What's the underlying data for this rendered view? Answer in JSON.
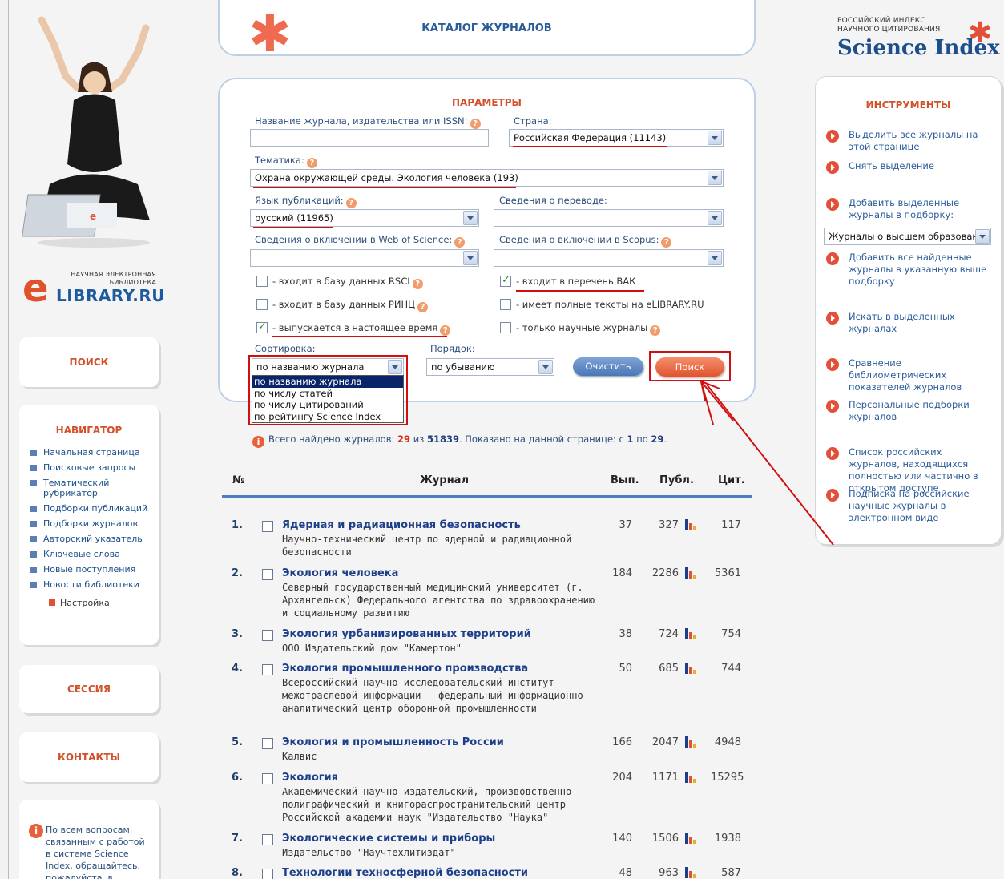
{
  "left": {
    "logo_small": "НАУЧНАЯ ЭЛЕКТРОННАЯ\nБИБЛИОТЕКА",
    "logo_e": "e",
    "logo_lib": "LIBRARY.RU",
    "search_label": "ПОИСК",
    "navigator_title": "НАВИГАТОР",
    "nav_items": [
      "Начальная страница",
      "Поисковые запросы",
      "Тематический рубрикатор",
      "Подборки публикаций",
      "Подборки журналов",
      "Авторский указатель",
      "Ключевые слова",
      "Новые поступления",
      "Новости библиотеки"
    ],
    "nav_settings": "Настройка",
    "session_label": "СЕССИЯ",
    "contacts_label": "КОНТАКТЫ",
    "help_text": "По всем вопросам, связанным с работой в системе Science Index, обращайтесь, пожалуйста, в"
  },
  "header": {
    "title": "КАТАЛОГ ЖУРНАЛОВ"
  },
  "params": {
    "title": "ПАРАМЕТРЫ",
    "name_label": "Название журнала, издательства или ISSN:",
    "name_value": "",
    "country_label": "Страна:",
    "country_value": "Российская Федерация  (11143)",
    "topic_label": "Тематика:",
    "topic_value": "Охрана окружающей среды. Экология человека  (193)",
    "lang_label": "Язык публикаций:",
    "lang_value": "русский  (11965)",
    "translation_label": "Сведения о переводе:",
    "translation_value": "",
    "wos_label": "Сведения о включении в Web of Science:",
    "wos_value": "",
    "scopus_label": "Сведения о включении в Scopus:",
    "scopus_value": "",
    "cb_rsci": "- входит в базу данных RSCI",
    "cb_vak": "- входит в перечень ВАК",
    "cb_rinc": "- входит в базу данных РИНЦ",
    "cb_fulltext": "- имеет полные тексты на eLIBRARY.RU",
    "cb_current": "- выпускается в настоящее время",
    "cb_scientific": "- только научные журналы",
    "sort_label": "Сортировка:",
    "sort_value": "по названию журнала",
    "sort_options": [
      "по названию журнала",
      "по числу статей",
      "по числу цитирований",
      "по рейтингу Science Index"
    ],
    "order_label": "Порядок:",
    "order_value": "по убыванию",
    "clear_button": "Очистить",
    "search_button": "Поиск"
  },
  "found": {
    "prefix": "Всего найдено журналов:",
    "count": "29",
    "of": "из",
    "total": "51839",
    "shown": ".   Показано на данной странице: с",
    "from": "1",
    "to_word": "по",
    "to": "29",
    "end": "."
  },
  "table": {
    "headers": {
      "num": "№",
      "journal": "Журнал",
      "issues": "Вып.",
      "pubs": "Публ.",
      "cites": "Цит."
    },
    "rows": [
      {
        "num": "1.",
        "title": "Ядерная и радиационная безопасность",
        "publisher": "Научно-технический центр по ядерной и радиационной безопасности",
        "issues": "37",
        "pubs": "327",
        "cites": "117"
      },
      {
        "num": "2.",
        "title": "Экология человека",
        "publisher": "Северный государственный медицинский университет (г. Архангельск) Федерального агентства по здравоохранению и социальному развитию",
        "issues": "184",
        "pubs": "2286",
        "cites": "5361"
      },
      {
        "num": "3.",
        "title": "Экология урбанизированных территорий",
        "publisher": "ООО Издательский дом \"Камертон\"",
        "issues": "38",
        "pubs": "724",
        "cites": "754"
      },
      {
        "num": "4.",
        "title": "Экология промышленного производства",
        "publisher": "Всероссийский научно-исследовательский институт межотраслевой информации - федеральный информационно-аналитический центр оборонной промышленности",
        "issues": "50",
        "pubs": "685",
        "cites": "744"
      },
      {
        "num": "5.",
        "title": "Экология и промышленность России",
        "publisher": "Калвис",
        "issues": "166",
        "pubs": "2047",
        "cites": "4948"
      },
      {
        "num": "6.",
        "title": "Экология",
        "publisher": "Академический научно-издательский, производственно-полиграфический и книгораспространительский центр Российской академии наук \"Издательство \"Наука\"",
        "issues": "204",
        "pubs": "1171",
        "cites": "15295"
      },
      {
        "num": "7.",
        "title": "Экологические системы и приборы",
        "publisher": "Издательство \"Научтехлитиздат\"",
        "issues": "140",
        "pubs": "1506",
        "cites": "1938"
      },
      {
        "num": "8.",
        "title": "Технологии техносферной безопасности",
        "publisher": "",
        "issues": "48",
        "pubs": "963",
        "cites": "587"
      }
    ]
  },
  "right": {
    "si_small": "РОССИЙСКИЙ ИНДЕКС\nНАУЧНОГО ЦИТИРОВАНИЯ",
    "si_big": "Science Index",
    "tools_title": "ИНСТРУМЕНТЫ",
    "tools": [
      "Выделить все журналы на этой странице",
      "Снять выделение",
      "Добавить выделенные журналы в подборку:",
      "Добавить все найденные журналы в указанную выше подборку",
      "Искать в выделенных журналах",
      "Сравнение библиометрических показателей журналов",
      "Персональные подборки журналов",
      "Список российских журналов, находящихся полностью или частично в открытом доступе",
      "Подписка на российские научные журналы в электронном виде"
    ],
    "collection_select": "Журналы о высшем образовани"
  },
  "colors": {
    "accent_orange": "#e2503a",
    "link_blue": "#1d3f8a",
    "annotation_red": "#d01010"
  }
}
